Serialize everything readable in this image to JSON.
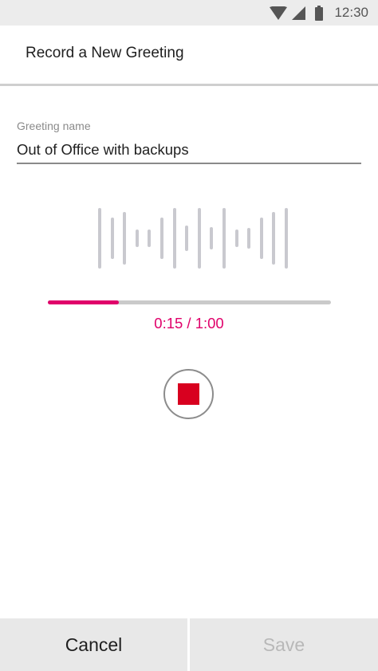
{
  "status_bar": {
    "time": "12:30",
    "icons": [
      "wifi-icon",
      "signal-icon",
      "battery-icon"
    ]
  },
  "header": {
    "title": "Record a New Greeting"
  },
  "greeting_field": {
    "label": "Greeting name",
    "value": "Out of Office with backups"
  },
  "recording": {
    "elapsed": "0:15",
    "total": "1:00",
    "readout": "0:15 / 1:00",
    "progress_fraction": 0.25,
    "waveform_levels": [
      1.0,
      0.68,
      0.86,
      0.28,
      0.28,
      0.68,
      1.0,
      0.42,
      1.0,
      0.36,
      1.0,
      0.28,
      0.34,
      0.68,
      0.86,
      1.0
    ],
    "stop_icon": "stop-icon"
  },
  "actions": {
    "cancel_label": "Cancel",
    "save_label": "Save",
    "save_enabled": false
  },
  "colors": {
    "accent": "#e0006a",
    "stop": "#d8001f",
    "waveform": "#c9c9cf",
    "disabled_text": "#b8b8b8"
  }
}
